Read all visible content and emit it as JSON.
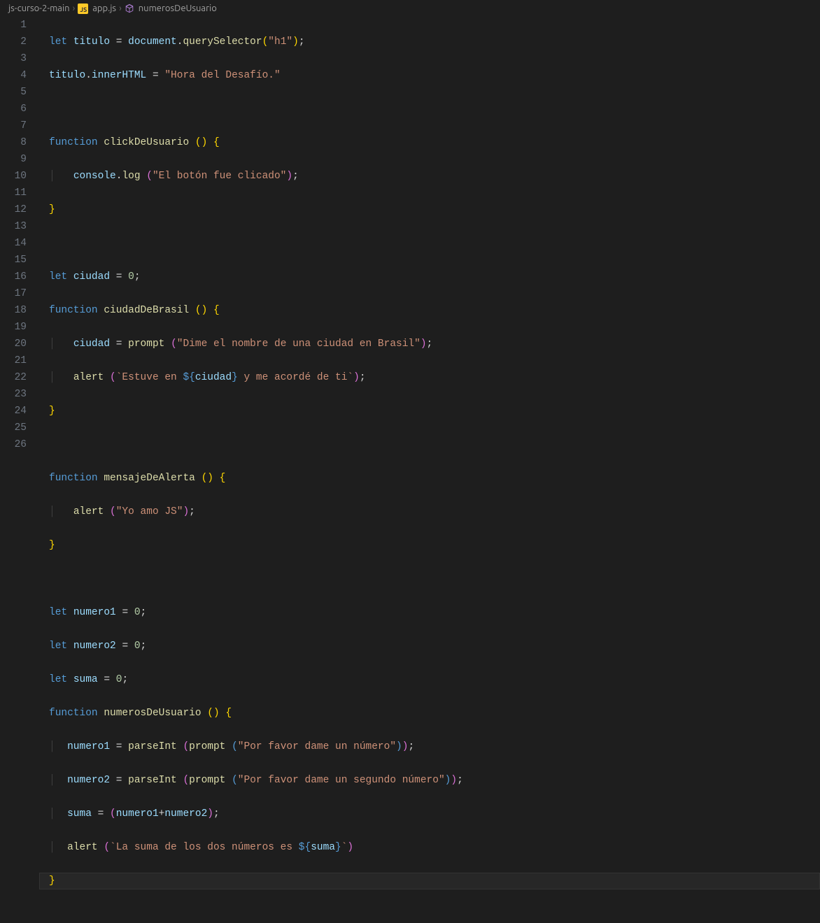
{
  "breadcrumb": {
    "folder": "js-curso-2-main",
    "fileBadge": "JS",
    "file": "app.js",
    "symbol": "numerosDeUsuario"
  },
  "gutter": [
    "1",
    "2",
    "3",
    "4",
    "5",
    "6",
    "7",
    "8",
    "9",
    "10",
    "11",
    "12",
    "13",
    "14",
    "15",
    "16",
    "17",
    "18",
    "19",
    "20",
    "21",
    "22",
    "23",
    "24",
    "25",
    "26"
  ],
  "tok": {
    "let": "let",
    "function": "function",
    "titulo": "titulo",
    "document": "document",
    "querySelector": "querySelector",
    "h1": "\"h1\"",
    "innerHTML": "innerHTML",
    "horaDesafio": "\"Hora del Desafío.\"",
    "clickDeUsuario": "clickDeUsuario",
    "console": "console",
    "log": "log",
    "botonClicado": "\"El botón fue clicado\"",
    "ciudad": "ciudad",
    "zero": "0",
    "ciudadDeBrasil": "ciudadDeBrasil",
    "prompt": "prompt",
    "dimeCiudad": "\"Dime el nombre de una ciudad en Brasil\"",
    "alert": "alert",
    "estuve1": "`Estuve en ",
    "estuve2": " y me acordé de ti`",
    "mensajeDeAlerta": "mensajeDeAlerta",
    "yoAmoJS": "\"Yo amo JS\"",
    "numero1": "numero1",
    "numero2": "numero2",
    "suma": "suma",
    "numerosDeUsuario": "numerosDeUsuario",
    "parseInt": "parseInt",
    "dame1": "\"Por favor dame un número\"",
    "dame2": "\"Por favor dame un segundo número\"",
    "laSuma1": "`La suma de los dos números es ",
    "laSuma2": "`",
    "tplOpen": "${",
    "tplClose": "}"
  }
}
